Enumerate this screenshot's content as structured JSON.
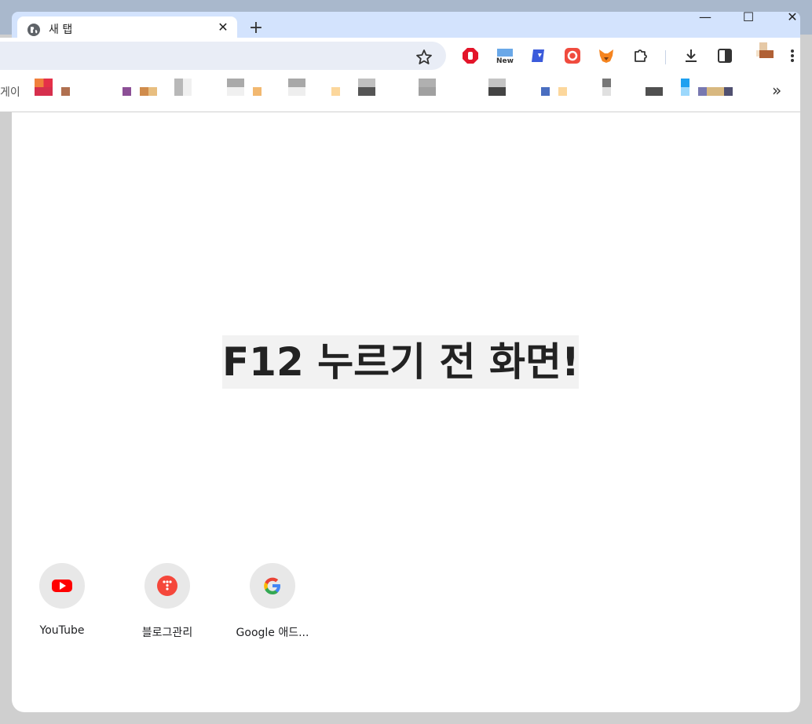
{
  "window": {
    "tab": {
      "title": "새 탭",
      "close_symbol": "✕"
    },
    "new_tab_symbol": "+",
    "controls": {
      "minimize": "—",
      "maximize": "☐",
      "close": "✕"
    }
  },
  "bookmarks": {
    "prefix": "게이",
    "more_symbol": "»"
  },
  "main": {
    "headline": "F12 누르기 전 화면!"
  },
  "shortcuts": [
    {
      "label": "YouTube",
      "icon": "youtube-icon"
    },
    {
      "label": "블로그관리",
      "icon": "tistory-icon"
    },
    {
      "label": "Google 애드...",
      "icon": "google-icon"
    }
  ],
  "colors": {
    "accent": "#d3e3fd",
    "titlebar": "#a9b8cc"
  }
}
